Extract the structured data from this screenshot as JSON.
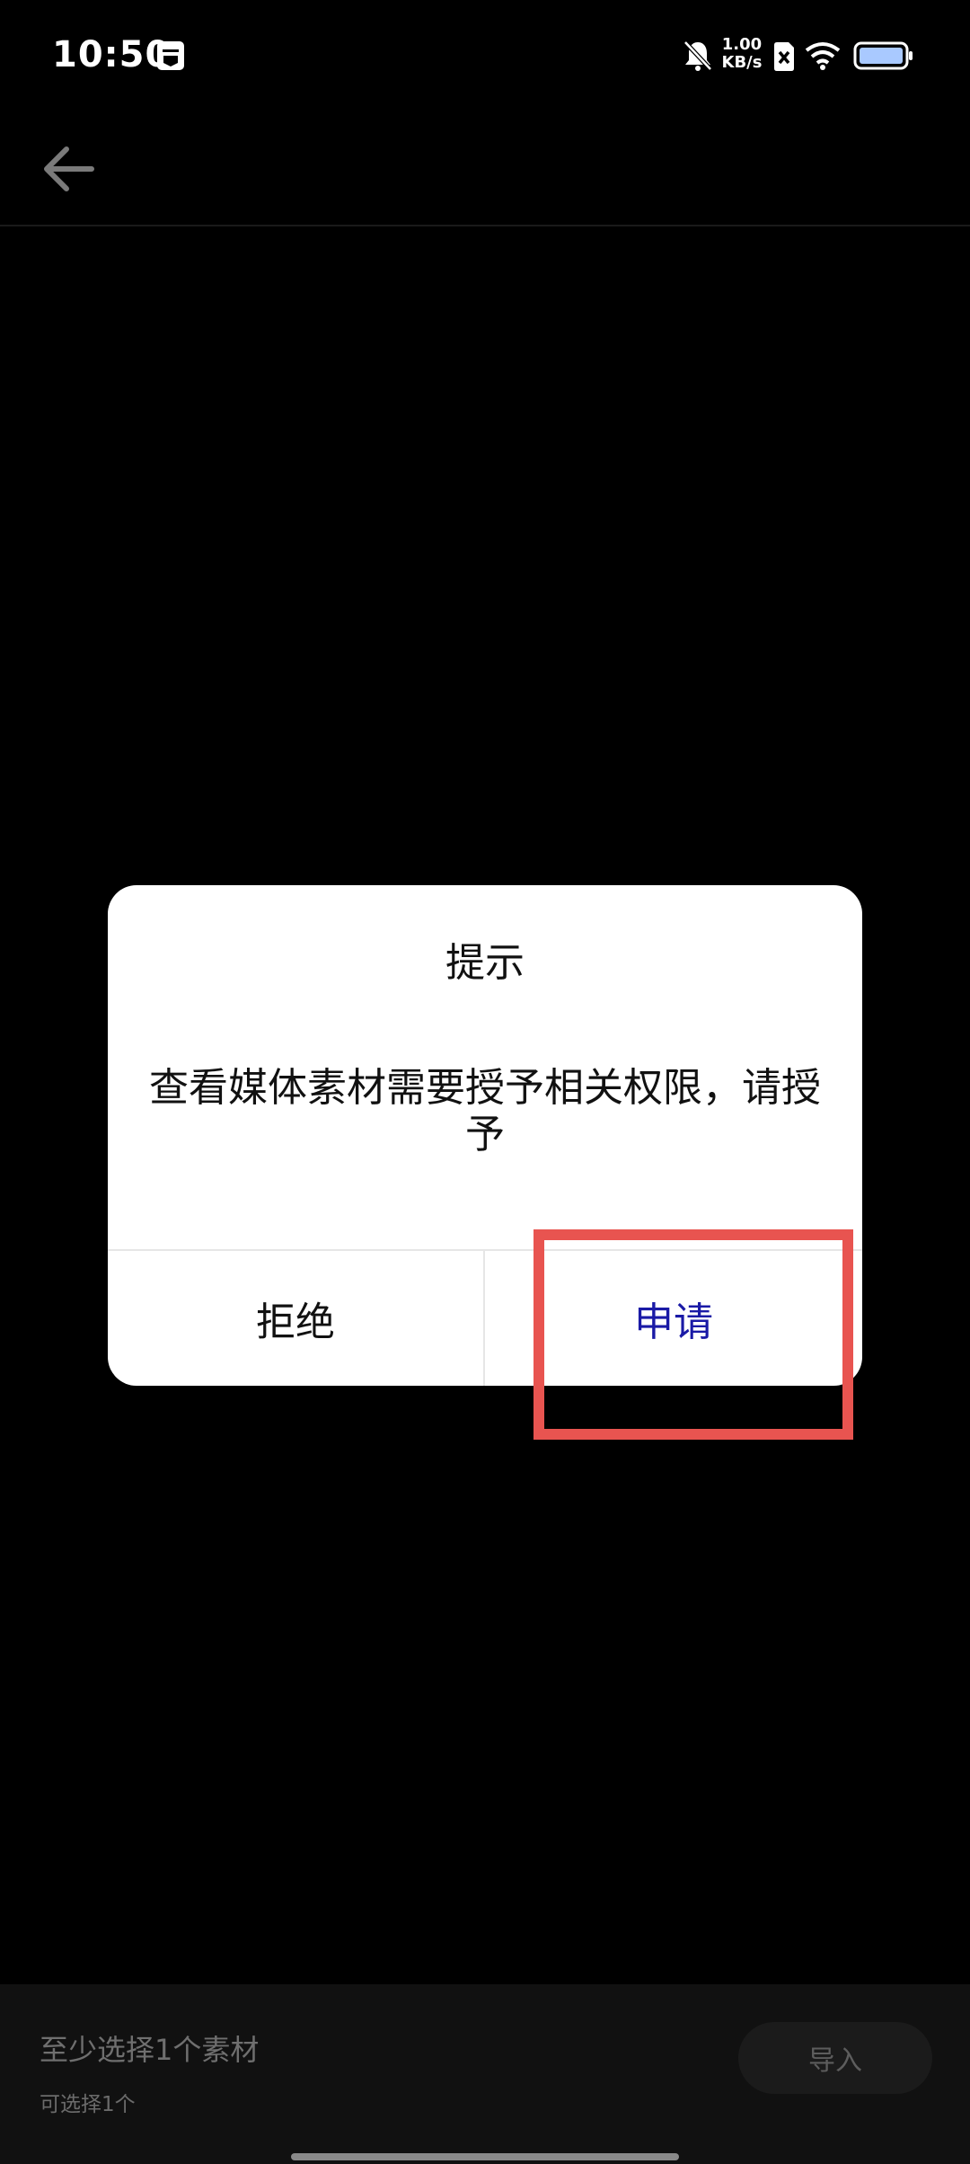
{
  "status_bar": {
    "time": "10:50",
    "net_speed_value": "1.00",
    "net_speed_unit": "KB/s",
    "icons": [
      "calendar-icon",
      "bell-off-icon",
      "sim-x-icon",
      "wifi-icon",
      "battery-icon"
    ]
  },
  "toolbar": {
    "back_icon": "arrow-left-icon"
  },
  "dialog": {
    "title": "提示",
    "message": "查看媒体素材需要授予相关权限，请授予",
    "reject_label": "拒绝",
    "apply_label": "申请"
  },
  "bottom_bar": {
    "title": "至少选择1个素材",
    "subtitle": "可选择1个",
    "import_label": "导入"
  },
  "colors": {
    "background": "#000000",
    "dialog_bg": "#ffffff",
    "accent_apply": "#1a1aa6",
    "highlight": "#e85450"
  }
}
